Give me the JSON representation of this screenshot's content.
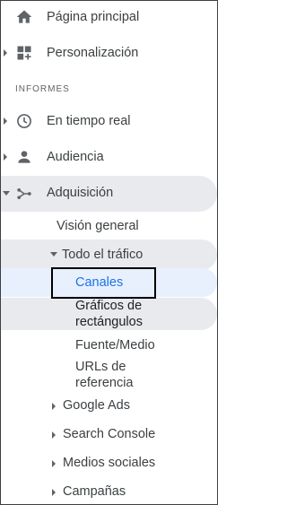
{
  "nav": {
    "home_label": "Página principal",
    "customization_label": "Personalización",
    "section_header": "INFORMES",
    "realtime_label": "En tiempo real",
    "audience_label": "Audiencia",
    "acquisition_label": "Adquisición",
    "overview_label": "Visión general",
    "all_traffic_label": "Todo el tráfico",
    "channels_label": "Canales",
    "treemaps_line1": "Gráficos de",
    "treemaps_line2": "rectángulos",
    "source_medium_label": "Fuente/Medio",
    "referrals_line1": "URLs de",
    "referrals_line2": "referencia",
    "google_ads_label": "Google Ads",
    "search_console_label": "Search Console",
    "social_label": "Medios sociales",
    "campaigns_label": "Campañas"
  },
  "colors": {
    "active_text": "#1a73e8",
    "active_bg": "#e8f0fe",
    "hover_band": "#e8eaed",
    "icon": "#5f6368",
    "text": "#3c4043"
  },
  "icons": {
    "home": "home-icon",
    "customization": "dashboard-plus-icon",
    "realtime": "clock-icon",
    "audience": "person-icon",
    "acquisition": "acquisition-branch-icon"
  }
}
